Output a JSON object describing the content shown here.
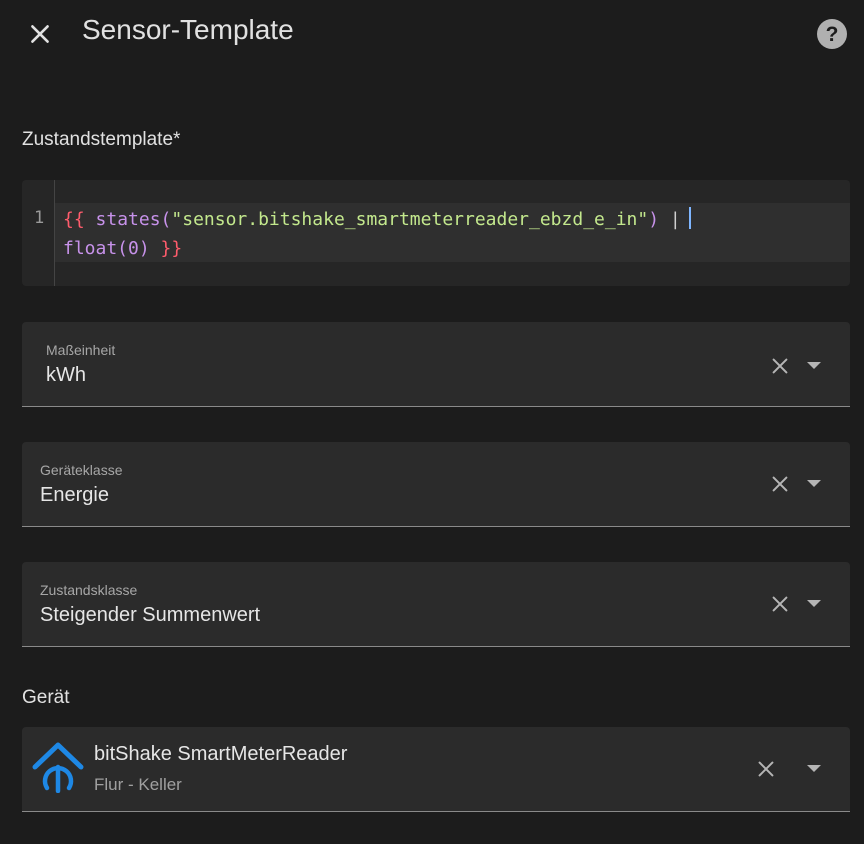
{
  "header": {
    "title": "Sensor-Template"
  },
  "state_template": {
    "label": "Zustandstemplate*",
    "line_number": "1",
    "code": {
      "open": "{{",
      "fn": "states(",
      "string": "\"sensor.bitshake_smartmeterreader_ebzd_e_in\"",
      "close_paren": ")",
      "pipe": "|",
      "filter": "float(0)",
      "close": "}}"
    }
  },
  "fields": {
    "unit": {
      "label": "Maßeinheit",
      "value": "kWh"
    },
    "device_class": {
      "label": "Geräteklasse",
      "value": "Energie"
    },
    "state_class": {
      "label": "Zustandsklasse",
      "value": "Steigender Summenwert"
    }
  },
  "device_section": {
    "label": "Gerät",
    "name": "bitShake SmartMeterReader",
    "area": "Flur - Keller"
  },
  "colors": {
    "background": "#1c1c1c",
    "field": "#2b2b2b",
    "accent_logo": "#1e88e5",
    "code_brace": "#ff5c6c",
    "code_function": "#c792ea",
    "code_string": "#c3e88d"
  },
  "icons": {
    "close": "close-icon",
    "help": "help-circle-icon",
    "clear": "close-icon",
    "dropdown": "menu-down-icon",
    "device_logo": "bitshake-logo-icon"
  }
}
